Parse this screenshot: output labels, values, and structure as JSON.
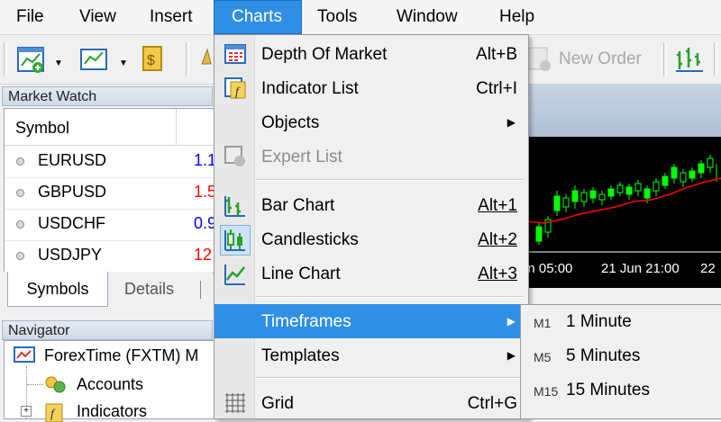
{
  "menubar": {
    "items": [
      {
        "label": "File"
      },
      {
        "label": "View"
      },
      {
        "label": "Insert"
      },
      {
        "label": "Charts"
      },
      {
        "label": "Tools"
      },
      {
        "label": "Window"
      },
      {
        "label": "Help"
      }
    ]
  },
  "toolbar": {
    "new_order_label": "New Order"
  },
  "market_watch": {
    "title": "Market Watch",
    "column_symbol": "Symbol",
    "rows": [
      {
        "symbol": "EURUSD",
        "bid": "1.1",
        "color": "#0000ff"
      },
      {
        "symbol": "GBPUSD",
        "bid": "1.5",
        "color": "#ff0000"
      },
      {
        "symbol": "USDCHF",
        "bid": "0.9",
        "color": "#0000ff"
      },
      {
        "symbol": "USDJPY",
        "bid": "12",
        "color": "#ff0000"
      }
    ],
    "tabs": [
      "Symbols",
      "Details"
    ]
  },
  "navigator": {
    "title": "Navigator",
    "items": [
      "ForexTime (FXTM) M",
      "Accounts",
      "Indicators"
    ]
  },
  "chart": {
    "time_labels": [
      "un 05:00",
      "21 Jun 21:00",
      "22"
    ]
  },
  "charts_menu": {
    "items": [
      {
        "label": "Depth Of Market",
        "shortcut": "Alt+B",
        "icon": "depth-of-market-icon"
      },
      {
        "label": "Indicator List",
        "shortcut": "Ctrl+I",
        "icon": "indicator-list-icon"
      },
      {
        "label": "Objects",
        "shortcut": "",
        "icon": ""
      },
      {
        "label": "Expert List",
        "shortcut": "",
        "icon": "expert-list-icon"
      },
      {
        "label": "Bar Chart",
        "shortcut": "Alt+1",
        "icon": "bar-chart-icon"
      },
      {
        "label": "Candlesticks",
        "shortcut": "Alt+2",
        "icon": "candlesticks-icon"
      },
      {
        "label": "Line Chart",
        "shortcut": "Alt+3",
        "icon": "line-chart-icon"
      },
      {
        "label": "Timeframes",
        "shortcut": "",
        "icon": ""
      },
      {
        "label": "Templates",
        "shortcut": "",
        "icon": ""
      },
      {
        "label": "Grid",
        "shortcut": "Ctrl+G",
        "icon": "grid-icon"
      }
    ],
    "submenu_arrow": "▶"
  },
  "timeframes_submenu": {
    "items": [
      {
        "code": "M1",
        "label": "1 Minute"
      },
      {
        "code": "M5",
        "label": "5 Minutes"
      },
      {
        "code": "M15",
        "label": "15 Minutes"
      }
    ]
  },
  "colors": {
    "selection": "#2f8fe4",
    "bull_candle": "#00ff00",
    "moving_average": "#ff0000",
    "chart_bg": "#000000"
  }
}
